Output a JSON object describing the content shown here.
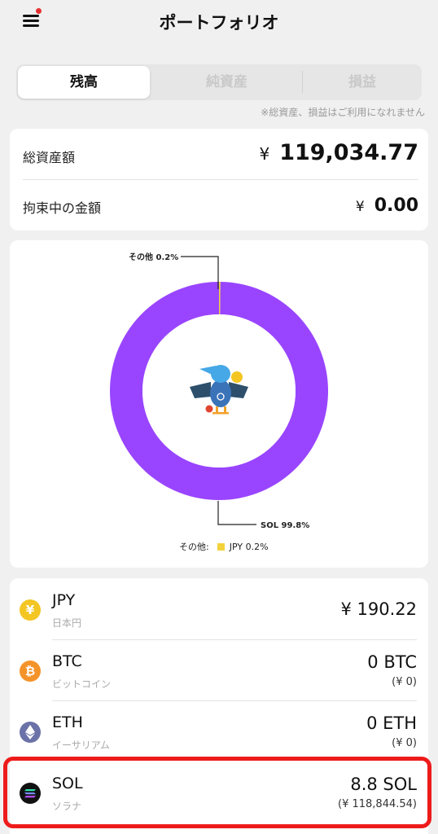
{
  "header": {
    "title": "ポートフォリオ"
  },
  "tabs": [
    {
      "label": "残高",
      "active": true
    },
    {
      "label": "純資産",
      "active": false
    },
    {
      "label": "損益",
      "active": false
    }
  ],
  "note": "※総資産、損益はご利用になれません",
  "summary": {
    "total_label": "総資産額",
    "total_currency": "¥",
    "total_value": "119,034.77",
    "locked_label": "拘束中の金額",
    "locked_currency": "¥",
    "locked_value": "0.00"
  },
  "chart": {
    "label_other": "その他 0.2%",
    "label_sol": "SOL 99.8%",
    "legend_prefix": "その他:",
    "legend_item": "JPY 0.2%",
    "colors": {
      "sol": "#9945ff",
      "jpy": "#f3d23b"
    }
  },
  "chart_data": {
    "type": "pie",
    "categories": [
      "SOL",
      "その他"
    ],
    "values": [
      99.8,
      0.2
    ]
  },
  "assets": [
    {
      "symbol": "JPY",
      "name": "日本円",
      "amount": "¥ 190.22",
      "yen": "",
      "icon": "yen-coin-icon",
      "color": "#f3c623"
    },
    {
      "symbol": "BTC",
      "name": "ビットコイン",
      "amount": "0 BTC",
      "yen": "(¥ 0)",
      "icon": "bitcoin-icon",
      "color": "#f4932a"
    },
    {
      "symbol": "ETH",
      "name": "イーサリアム",
      "amount": "0 ETH",
      "yen": "(¥ 0)",
      "icon": "ethereum-icon",
      "color": "#6b72a8"
    },
    {
      "symbol": "SOL",
      "name": "ソラナ",
      "amount": "8.8 SOL",
      "yen": "(¥ 118,844.54)",
      "icon": "solana-icon",
      "color": "#111111"
    }
  ]
}
